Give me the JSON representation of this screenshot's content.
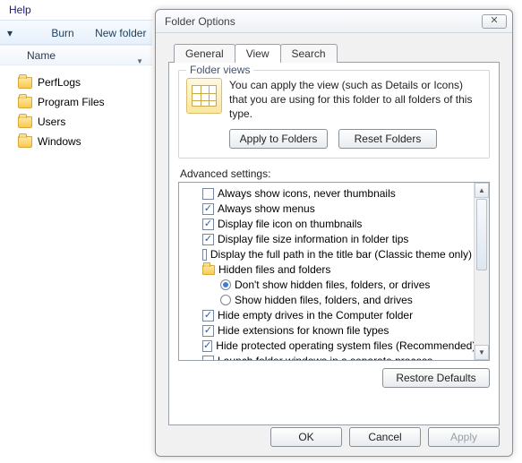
{
  "menu": {
    "help": "Help"
  },
  "toolbar": {
    "arrow": "▾",
    "burn": "Burn",
    "new_folder": "New folder"
  },
  "pane": {
    "header": "Name",
    "items": [
      "PerfLogs",
      "Program Files",
      "Users",
      "Windows"
    ]
  },
  "dialog": {
    "title": "Folder Options",
    "close_glyph": "✕",
    "tabs": {
      "general": "General",
      "view": "View",
      "search": "Search"
    },
    "folder_views": {
      "legend": "Folder views",
      "text": "You can apply the view (such as Details or Icons) that you are using for this folder to all folders of this type.",
      "apply": "Apply to Folders",
      "reset": "Reset Folders"
    },
    "advanced_label": "Advanced settings:",
    "settings": [
      {
        "type": "check",
        "checked": false,
        "label": "Always show icons, never thumbnails"
      },
      {
        "type": "check",
        "checked": true,
        "label": "Always show menus"
      },
      {
        "type": "check",
        "checked": true,
        "label": "Display file icon on thumbnails"
      },
      {
        "type": "check",
        "checked": true,
        "label": "Display file size information in folder tips"
      },
      {
        "type": "check",
        "checked": false,
        "label": "Display the full path in the title bar (Classic theme only)"
      },
      {
        "type": "folder",
        "label": "Hidden files and folders"
      },
      {
        "type": "radio",
        "selected": true,
        "label": "Don't show hidden files, folders, or drives"
      },
      {
        "type": "radio",
        "selected": false,
        "label": "Show hidden files, folders, and drives"
      },
      {
        "type": "check",
        "checked": true,
        "label": "Hide empty drives in the Computer folder"
      },
      {
        "type": "check",
        "checked": true,
        "label": "Hide extensions for known file types"
      },
      {
        "type": "check",
        "checked": true,
        "label": "Hide protected operating system files (Recommended)"
      },
      {
        "type": "check",
        "checked": false,
        "label": "Launch folder windows in a separate process"
      }
    ],
    "restore": "Restore Defaults",
    "buttons": {
      "ok": "OK",
      "cancel": "Cancel",
      "apply": "Apply"
    }
  }
}
